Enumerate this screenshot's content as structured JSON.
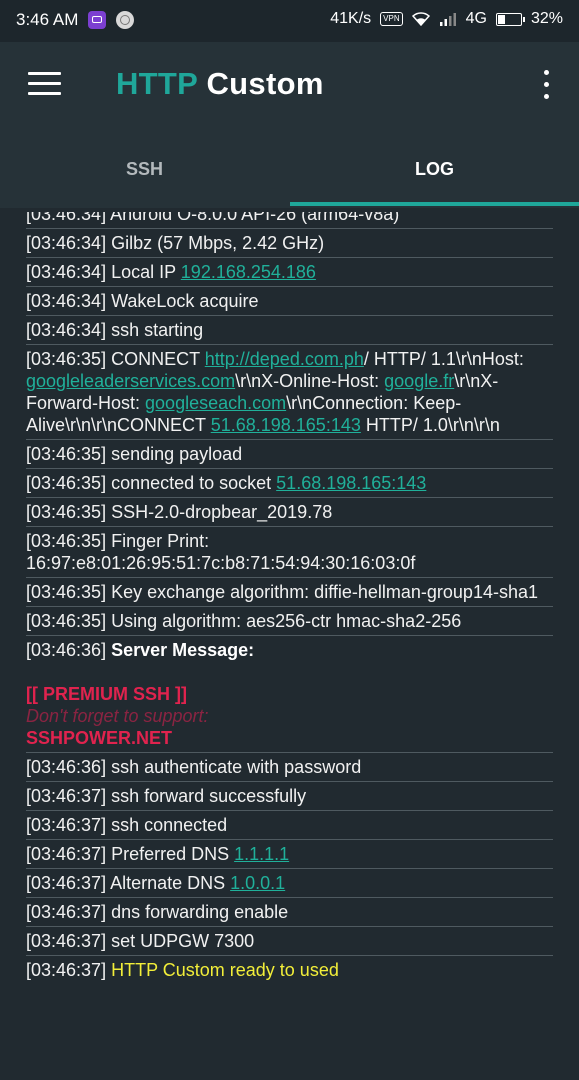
{
  "status_bar": {
    "time": "3:46 AM",
    "speed": "41K/s",
    "vpn": "VPN",
    "network": "4G",
    "battery": "32%",
    "battery_level": 0.32
  },
  "app_bar": {
    "title_accent": "HTTP",
    "title_rest": "Custom"
  },
  "tabs": [
    {
      "label": "SSH",
      "selected": false
    },
    {
      "label": "LOG",
      "selected": true
    }
  ],
  "colors": {
    "accent": "#1fa79a",
    "background": "#212a30",
    "toolbar": "#263238",
    "link": "#20b09a",
    "ready": "#f2ee39",
    "premium": "#e0234e"
  },
  "log": {
    "e0": "[03:46:34] Android O-8.0.0 API-26 (arm64-v8a)",
    "e1": "[03:46:34] Gilbz (57 Mbps, 2.42 GHz)",
    "e2_text": "[03:46:34] Local IP ",
    "e2_ip": "192.168.254.186",
    "e3": "[03:46:34] WakeLock acquire",
    "e4": "[03:46:34] ssh starting",
    "e5_a": "[03:46:35] CONNECT ",
    "e5_url": "http://deped.com.ph",
    "e5_b": "/ HTTP/ 1.1\\r\\nHost: ",
    "e5_host": "googleleaderservices.com",
    "e5_c": "\\r\\nX-Online-Host: ",
    "e5_online": "google.fr",
    "e5_d": "\\r\\nX-Forward-Host: ",
    "e5_forward": "googleseach.com",
    "e5_e": "\\r\\nConnection: Keep-Alive\\r\\n\\r\\nCONNECT ",
    "e5_server": "51.68.198.165:143",
    "e5_f": " HTTP/ 1.0\\r\\n\\r\\n",
    "e6": "[03:46:35] sending payload",
    "e7_text": "[03:46:35] connected to socket ",
    "e7_ip": "51.68.198.165:143",
    "e8": "[03:46:35] SSH-2.0-dropbear_2019.78",
    "e9": "[03:46:35] Finger Print: 16:97:e8:01:26:95:51:7c:b8:71:54:94:30:16:03:0f",
    "e10": "[03:46:35] Key exchange algorithm: diffie-hellman-group14-sha1",
    "e11": "[03:46:35] Using algorithm: aes256-ctr hmac-sha2-256",
    "e12_time": "[03:46:36] ",
    "e12_bold": "Server Message:",
    "premium": "[[ PREMIUM SSH ]]",
    "support": "Don't forget to support:",
    "sshpower": "SSHPOWER.NET",
    "e13": "[03:46:36] ssh authenticate with password",
    "e14": "[03:46:37] ssh forward successfully",
    "e15": "[03:46:37] ssh connected",
    "e16_text": "[03:46:37] Preferred DNS ",
    "e16_dns": "1.1.1.1",
    "e17_text": "[03:46:37] Alternate DNS ",
    "e17_dns": "1.0.0.1",
    "e18": "[03:46:37] dns forwarding enable",
    "e19": "[03:46:37] set UDPGW 7300",
    "e20_time": "[03:46:37] ",
    "e20_ready": "HTTP Custom ready to used"
  }
}
